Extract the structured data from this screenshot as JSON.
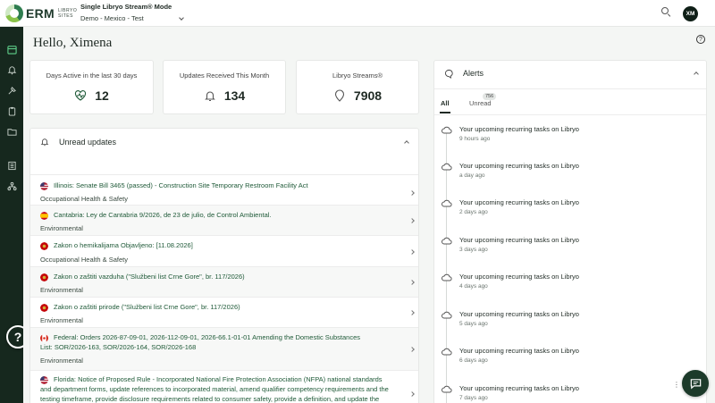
{
  "topbar": {
    "logo_text": "ERM",
    "logo_sub_line1": "LIBRYO",
    "logo_sub_line2": "SITES",
    "mode_title": "Single Libryo Stream® Mode",
    "stream_selector": "Demo - Mexico - Test",
    "avatar_initials": "XM"
  },
  "sidebar": {
    "icons": [
      "calendar-icon",
      "bell-icon",
      "hammer-icon",
      "clipboard-icon",
      "folder-icon",
      "list-icon",
      "sitemap-icon"
    ],
    "help_label": "?"
  },
  "main": {
    "greeting": "Hello, Ximena"
  },
  "stats": [
    {
      "label": "Days Active in the last 30 days",
      "value": "12",
      "icon": "heart-pulse-icon"
    },
    {
      "label": "Updates Received This Month",
      "value": "134",
      "icon": "bell-icon"
    },
    {
      "label": "Libryo Streams®",
      "value": "7908",
      "icon": "location-pin-icon"
    }
  ],
  "updates_panel": {
    "title": "Unread updates",
    "items": [
      {
        "flag": "us",
        "title_lines": [
          "Illinois: Senate Bill 3465 (passed) - Construction Site Temporary Restroom Facility Act"
        ],
        "category": "Occupational Health & Safety"
      },
      {
        "flag": "es",
        "title_lines": [
          "Cantabria: Ley de Cantabria 9/2026, de 23 de julio, de Control Ambiental."
        ],
        "category": "Environmental"
      },
      {
        "flag": "me",
        "title_lines": [
          "Zakon o hemikalijama Objavljeno: [11.08.2026]"
        ],
        "category": "Occupational Health & Safety"
      },
      {
        "flag": "me",
        "title_lines": [
          "Zakon o zaštiti vazduha (\"Službeni list Crne Gore\", br. 117/2026)"
        ],
        "category": "Environmental"
      },
      {
        "flag": "me",
        "title_lines": [
          "Zakon o zaštiti prirode (\"Službeni list Crne Gore\", br. 117/2026)"
        ],
        "category": "Environmental"
      },
      {
        "flag": "ca",
        "title_lines": [
          "Federal: Orders 2026-87-09-01, 2026-112-09-01, 2026-66.1-01-01 Amending the Domestic Substances",
          "List: SOR/2026-163, SOR/2026-164, SOR/2026-168"
        ],
        "category": "Environmental"
      },
      {
        "flag": "us",
        "title_lines": [
          "Florida: Notice of Proposed Rule - Incorporated National Fire Protection Association (NFPA) national standards",
          "and department forms, update references to incorporated material, amend qualifier competency requirements and the",
          "testing timeframe, provide disclosure requirements related to consumer safety, provide a definition, and update the"
        ],
        "category": ""
      }
    ]
  },
  "alerts_panel": {
    "title": "Alerts",
    "tabs": [
      {
        "label": "All"
      },
      {
        "label": "Unread"
      }
    ],
    "unread_count": "756",
    "items": [
      {
        "title": "Your upcoming recurring tasks on Libryo",
        "time": "9 hours ago"
      },
      {
        "title": "Your upcoming recurring tasks on Libryo",
        "time": "a day ago"
      },
      {
        "title": "Your upcoming recurring tasks on Libryo",
        "time": "2 days ago"
      },
      {
        "title": "Your upcoming recurring tasks on Libryo",
        "time": "3 days ago"
      },
      {
        "title": "Your upcoming recurring tasks on Libryo",
        "time": "4 days ago"
      },
      {
        "title": "Your upcoming recurring tasks on Libryo",
        "time": "5 days ago"
      },
      {
        "title": "Your upcoming recurring tasks on Libryo",
        "time": "6 days ago"
      },
      {
        "title": "Your upcoming recurring tasks on Libryo",
        "time": "7 days ago"
      }
    ]
  },
  "colors": {
    "sidebar": "#16281e",
    "accent_green": "#1f5a38",
    "background": "#f4f6f4"
  }
}
